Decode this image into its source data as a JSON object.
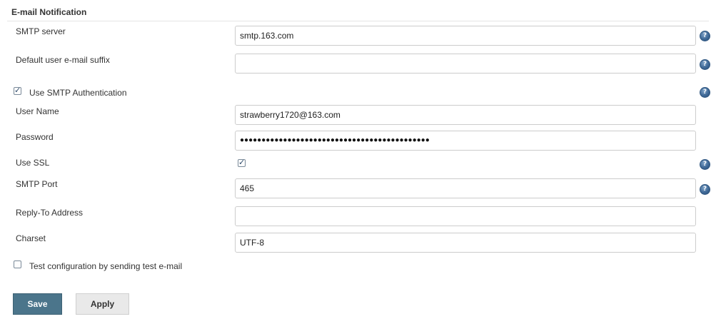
{
  "section": {
    "title": "E-mail Notification"
  },
  "smtp_server": {
    "label": "SMTP server",
    "value": "smtp.163.com"
  },
  "email_suffix": {
    "label": "Default user e-mail suffix",
    "value": ""
  },
  "smtp_auth": {
    "label": "Use SMTP Authentication",
    "checked": true
  },
  "user_name": {
    "label": "User Name",
    "value": "strawberry1720@163.com"
  },
  "password": {
    "label": "Password",
    "value": "●●●●●●●●●●●●●●●●●●●●●●●●●●●●●●●●●●●●●●●●●●●●"
  },
  "use_ssl": {
    "label": "Use SSL",
    "checked": true
  },
  "smtp_port": {
    "label": "SMTP Port",
    "value": "465"
  },
  "reply_to": {
    "label": "Reply-To Address",
    "value": ""
  },
  "charset": {
    "label": "Charset",
    "value": "UTF-8"
  },
  "test_config": {
    "label": "Test configuration by sending test e-mail",
    "checked": false
  },
  "buttons": {
    "save": "Save",
    "apply": "Apply"
  },
  "icons": {
    "help": "help-icon",
    "check": "checkmark-icon"
  },
  "colors": {
    "save_button": "#4b758b",
    "help_icon": "#3e6896"
  }
}
